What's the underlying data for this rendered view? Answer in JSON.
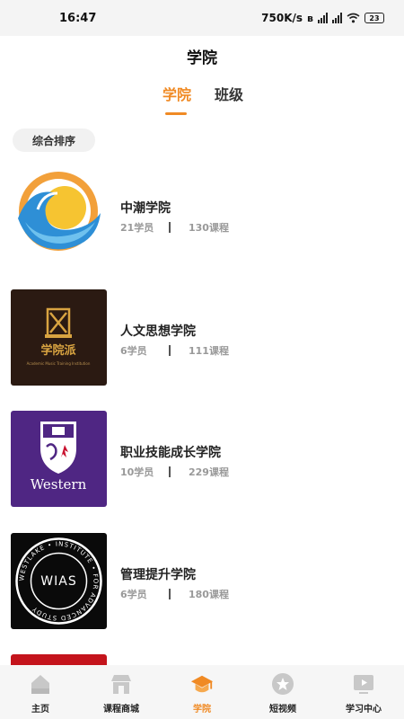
{
  "status_bar": {
    "time": "16:47",
    "speed": "750K/s",
    "battery": "23"
  },
  "header": {
    "title": "学院"
  },
  "tabs": [
    {
      "label": "学院"
    },
    {
      "label": "班级"
    }
  ],
  "sort": {
    "label": "综合排序"
  },
  "colleges": [
    {
      "name": "中潮学院",
      "students": "21学员",
      "courses": "130课程",
      "logo": "wave-globe-logo"
    },
    {
      "name": "人文思想学院",
      "students": "6学员",
      "courses": "111课程",
      "logo": "xueyuanpai-logo",
      "logo_text": "学院派",
      "logo_sub": "Academic Music Training Institution"
    },
    {
      "name": "职业技能成长学院",
      "students": "10学员",
      "courses": "229课程",
      "logo": "western-shield-logo",
      "logo_text": "Western"
    },
    {
      "name": "管理提升学院",
      "students": "6学员",
      "courses": "180课程",
      "logo": "wias-seal-logo",
      "logo_text": "WIAS",
      "logo_ring": "WESTLAKE • INSTITUTE • FOR ADVANCED STUDY"
    },
    {
      "logo": "red-logo"
    }
  ],
  "bottom_nav": [
    {
      "label": "主页",
      "icon": "home-icon"
    },
    {
      "label": "课程商城",
      "icon": "store-icon"
    },
    {
      "label": "学院",
      "icon": "graduation-cap-icon",
      "active": true
    },
    {
      "label": "短视频",
      "icon": "star-circle-icon"
    },
    {
      "label": "学习中心",
      "icon": "play-screen-icon"
    }
  ],
  "colors": {
    "accent": "#f08a24",
    "western_purple": "#4f2683"
  }
}
